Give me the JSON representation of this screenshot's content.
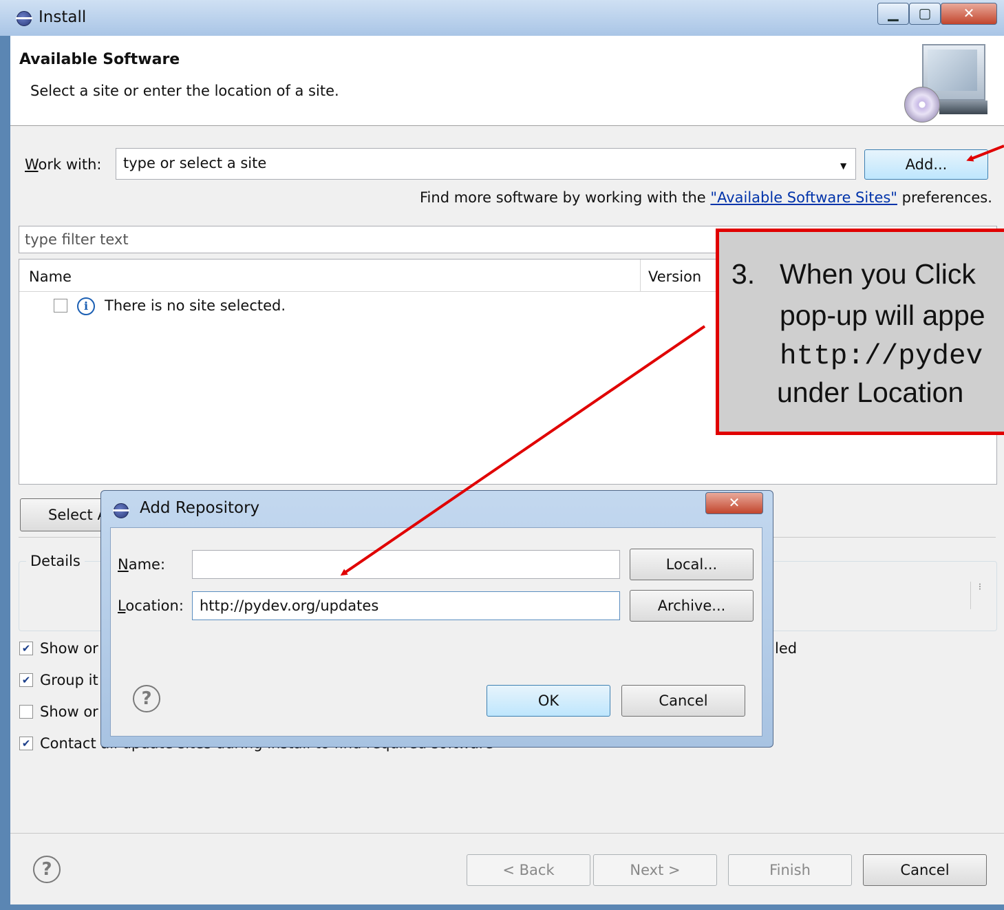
{
  "window": {
    "title": "Install",
    "controls": [
      "minimize",
      "maximize",
      "close"
    ]
  },
  "banner": {
    "heading": "Available Software",
    "description": "Select a site or enter the location of a site."
  },
  "work_with": {
    "label": "Work with:",
    "value": "type or select a site",
    "add_label": "Add...",
    "hint_prefix": "Find more software by working with the ",
    "hint_link": "\"Available Software Sites\"",
    "hint_suffix": " preferences."
  },
  "filter": {
    "placeholder": "type filter text"
  },
  "table": {
    "columns": [
      "Name",
      "Version"
    ],
    "rows": [
      {
        "text": "There is no site selected.",
        "checked": false
      }
    ]
  },
  "select_all_partial": "Select A",
  "details": {
    "label": "Details"
  },
  "options": [
    {
      "label": "Show or",
      "checked": true
    },
    {
      "label": "Group it",
      "checked": true
    },
    {
      "label": "Show or",
      "checked": false
    },
    {
      "label": "Contact all update sites during install to find required software",
      "checked": true
    }
  ],
  "options_trailing_text": "led",
  "footer": {
    "back": "< Back",
    "next": "Next >",
    "finish": "Finish",
    "cancel": "Cancel"
  },
  "dialog": {
    "title": "Add Repository",
    "name_label": "Name:",
    "name_value": "",
    "location_label": "Location:",
    "location_value": "http://pydev.org/updates",
    "local_label": "Local...",
    "archive_label": "Archive...",
    "ok_label": "OK",
    "cancel_label": "Cancel"
  },
  "annotation": {
    "number": "3.",
    "line1": "When you Click",
    "line2": "pop-up will appe",
    "line3": "http://pydev",
    "line4": "under Location",
    "colors": {
      "border": "#e00000",
      "arrow": "#e00000",
      "background": "#cfcfcf"
    }
  }
}
